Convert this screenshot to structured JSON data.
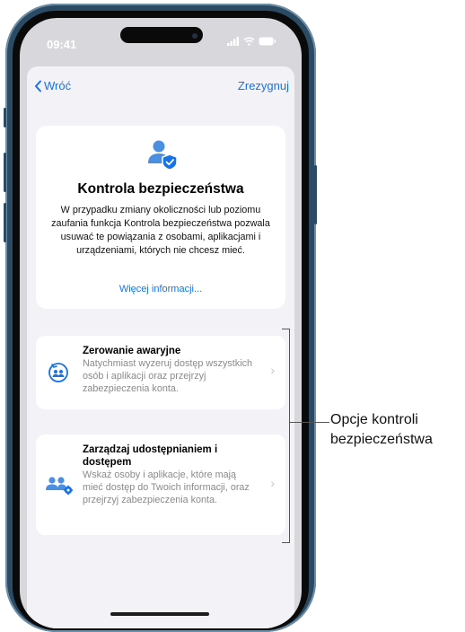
{
  "status_bar": {
    "time": "09:41"
  },
  "nav": {
    "back_label": "Wróć",
    "cancel_label": "Zrezygnuj"
  },
  "header_card": {
    "title": "Kontrola bezpieczeństwa",
    "description": "W przypadku zmiany okoliczności lub poziomu zaufania funkcja Kontrola bezpieczeństwa pozwala usuwać te powiązania z osobami, aplikacjami i urządzeniami, których nie chcesz mieć.",
    "link": "Więcej informacji..."
  },
  "options": [
    {
      "title": "Zerowanie awaryjne",
      "description": "Natychmiast wyzeruj dostęp wszystkich osób i aplikacji oraz przejrzyj zabezpieczenia konta."
    },
    {
      "title": "Zarządzaj udostępnianiem i dostępem",
      "description": "Wskaż osoby i aplikacje, które mają mieć dostęp do Twoich informacji, oraz przejrzyj zabezpieczenia konta."
    }
  ],
  "callout": {
    "label": "Opcje kontroli bezpieczeństwa"
  },
  "colors": {
    "accent": "#1673e6",
    "phone_frame": "#2b4a63"
  }
}
